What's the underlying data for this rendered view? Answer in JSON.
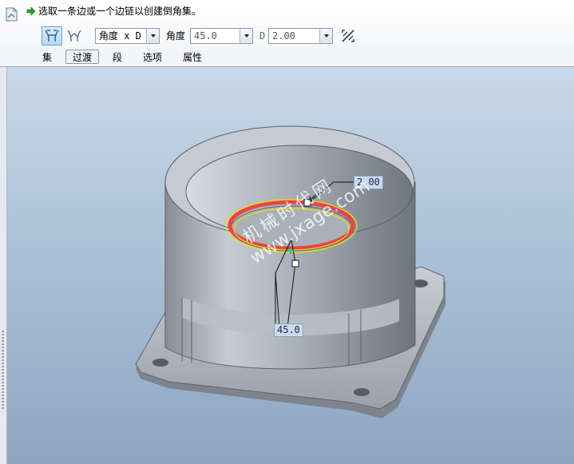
{
  "prompt": {
    "text": "选取一条边或一个边链以创建倒角集。"
  },
  "toolbar": {
    "scheme": {
      "value": "角度 x D"
    },
    "angle_label": "角度",
    "angle": {
      "value": "45.0"
    },
    "d_label": "D",
    "distance": {
      "value": "2.00"
    }
  },
  "tabs": [
    {
      "label": "集"
    },
    {
      "label": "过渡"
    },
    {
      "label": "段"
    },
    {
      "label": "选项"
    },
    {
      "label": "属性"
    }
  ],
  "model": {
    "dim_distance": "2.00",
    "dim_angle": "45.0"
  },
  "watermark": {
    "line1": "机械时代网",
    "line2": "www.jxage.com"
  },
  "colors": {
    "selected_edge": "#e8434a",
    "preview_edge": "#f0e000",
    "active_button": "#b7d8f5",
    "model_fill": "#9aa1aa"
  }
}
